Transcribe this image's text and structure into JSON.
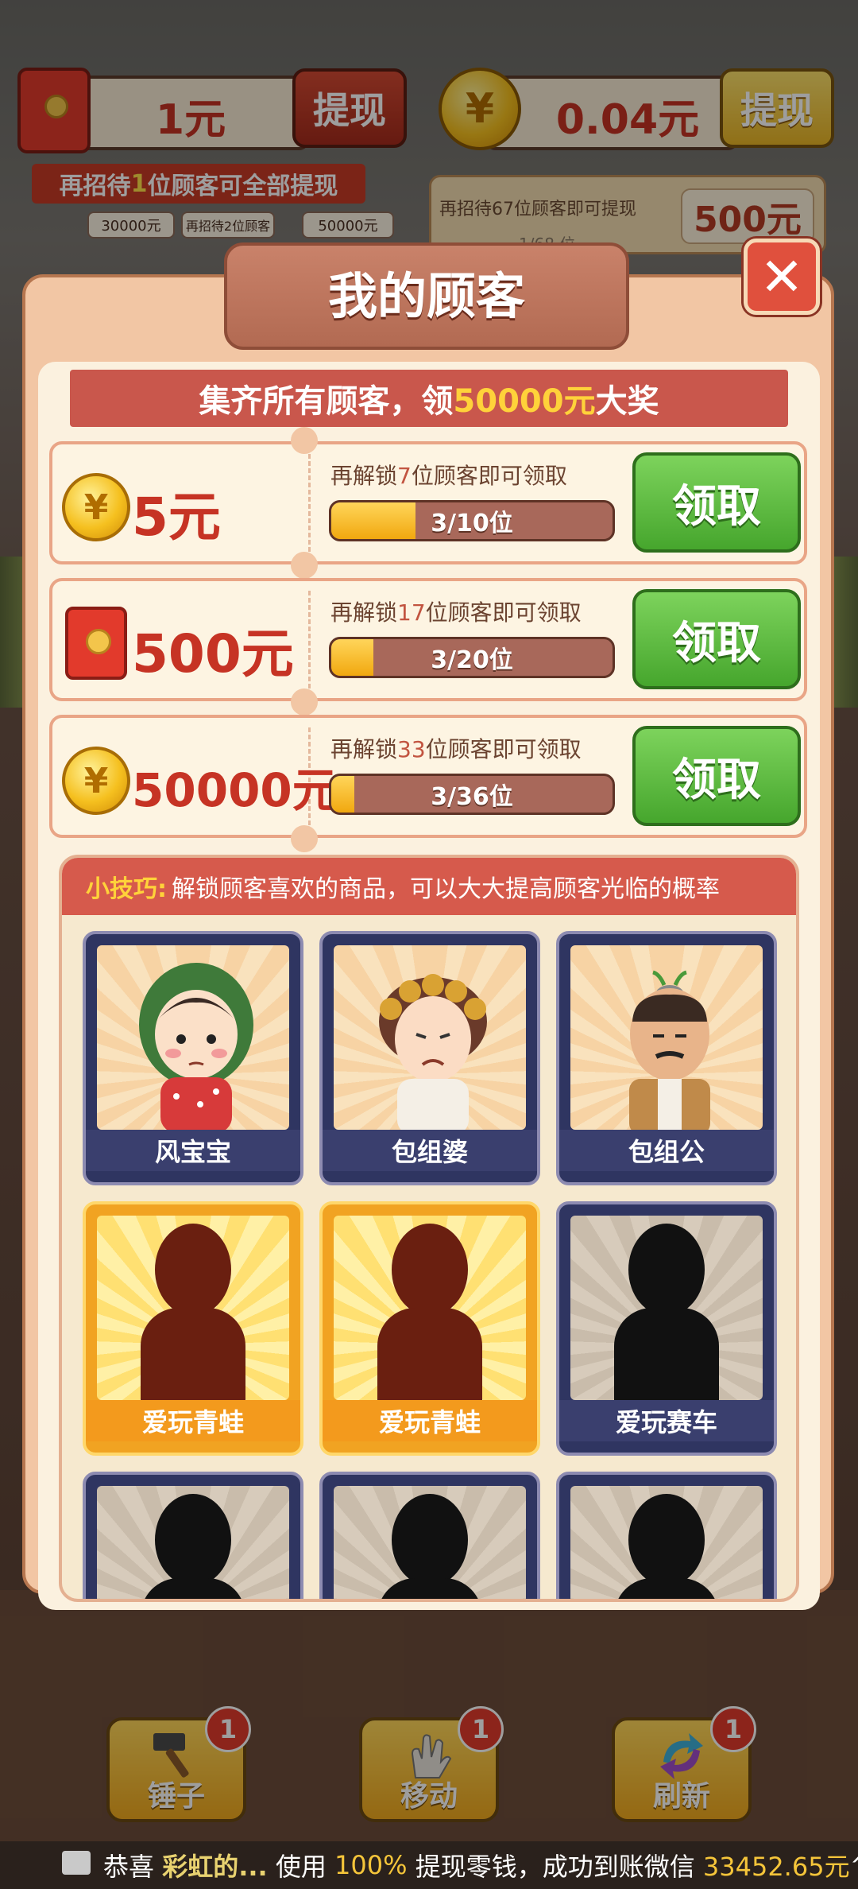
{
  "top_bar": {
    "cash_value": "1元",
    "cash_withdraw_label": "提现",
    "coin_value": "0.04元",
    "coin_withdraw_label": "提现",
    "hint_pre": "再招待",
    "hint_num": "1",
    "hint_post": "位顾客可全部提现",
    "tags": [
      "30000元",
      "再招待2位顾客",
      "50000元"
    ],
    "right_hint": "再招待67位顾客即可提现",
    "right_progress": "1/68 位",
    "right_reward": "500元"
  },
  "modal": {
    "title": "我的顾客",
    "close_label": "✕",
    "banner_pre": "集齐所有顾客，领",
    "banner_amount": "50000元",
    "banner_post": "大奖",
    "rewards": [
      {
        "icon": "coin-icon",
        "amount": "5元",
        "desc_pre": "再解锁",
        "desc_num": "7",
        "desc_post": "位顾客即可领取",
        "progress_text": "3/10位",
        "progress": 0.3,
        "claim_label": "领取"
      },
      {
        "icon": "red-envelope-icon",
        "amount": "500元",
        "desc_pre": "再解锁",
        "desc_num": "17",
        "desc_post": "位顾客即可领取",
        "progress_text": "3/20位",
        "progress": 0.15,
        "claim_label": "领取"
      },
      {
        "icon": "coin-icon",
        "amount": "50000元",
        "desc_pre": "再解锁",
        "desc_num": "33",
        "desc_post": "位顾客即可领取",
        "progress_text": "3/36位",
        "progress": 0.083,
        "claim_label": "领取"
      }
    ],
    "tip_label": "小技巧:",
    "tip_text": "解锁顾客喜欢的商品，可以大大提高顾客光临的概率",
    "customers": [
      {
        "name": "风宝宝",
        "state": "owned"
      },
      {
        "name": "包组婆",
        "state": "owned"
      },
      {
        "name": "包组公",
        "state": "owned"
      },
      {
        "name": "爱玩青蛙",
        "state": "highlight"
      },
      {
        "name": "爱玩青蛙",
        "state": "highlight"
      },
      {
        "name": "爱玩赛车",
        "state": "locked"
      },
      {
        "name": "",
        "state": "locked"
      },
      {
        "name": "",
        "state": "locked"
      },
      {
        "name": "",
        "state": "locked"
      }
    ]
  },
  "toolbar": {
    "tools": [
      {
        "label": "锤子",
        "badge": "1",
        "icon": "hammer-icon"
      },
      {
        "label": "移动",
        "badge": "1",
        "icon": "hand-icon"
      },
      {
        "label": "刷新",
        "badge": "1",
        "icon": "refresh-icon"
      }
    ]
  },
  "ticker": {
    "pre": "恭喜",
    "user": "彩虹的...",
    "mid1": "使用",
    "percent": "100%",
    "mid2": "提现零钱，成功到账微信",
    "amount": "33452.65元",
    "suffix": "^"
  }
}
